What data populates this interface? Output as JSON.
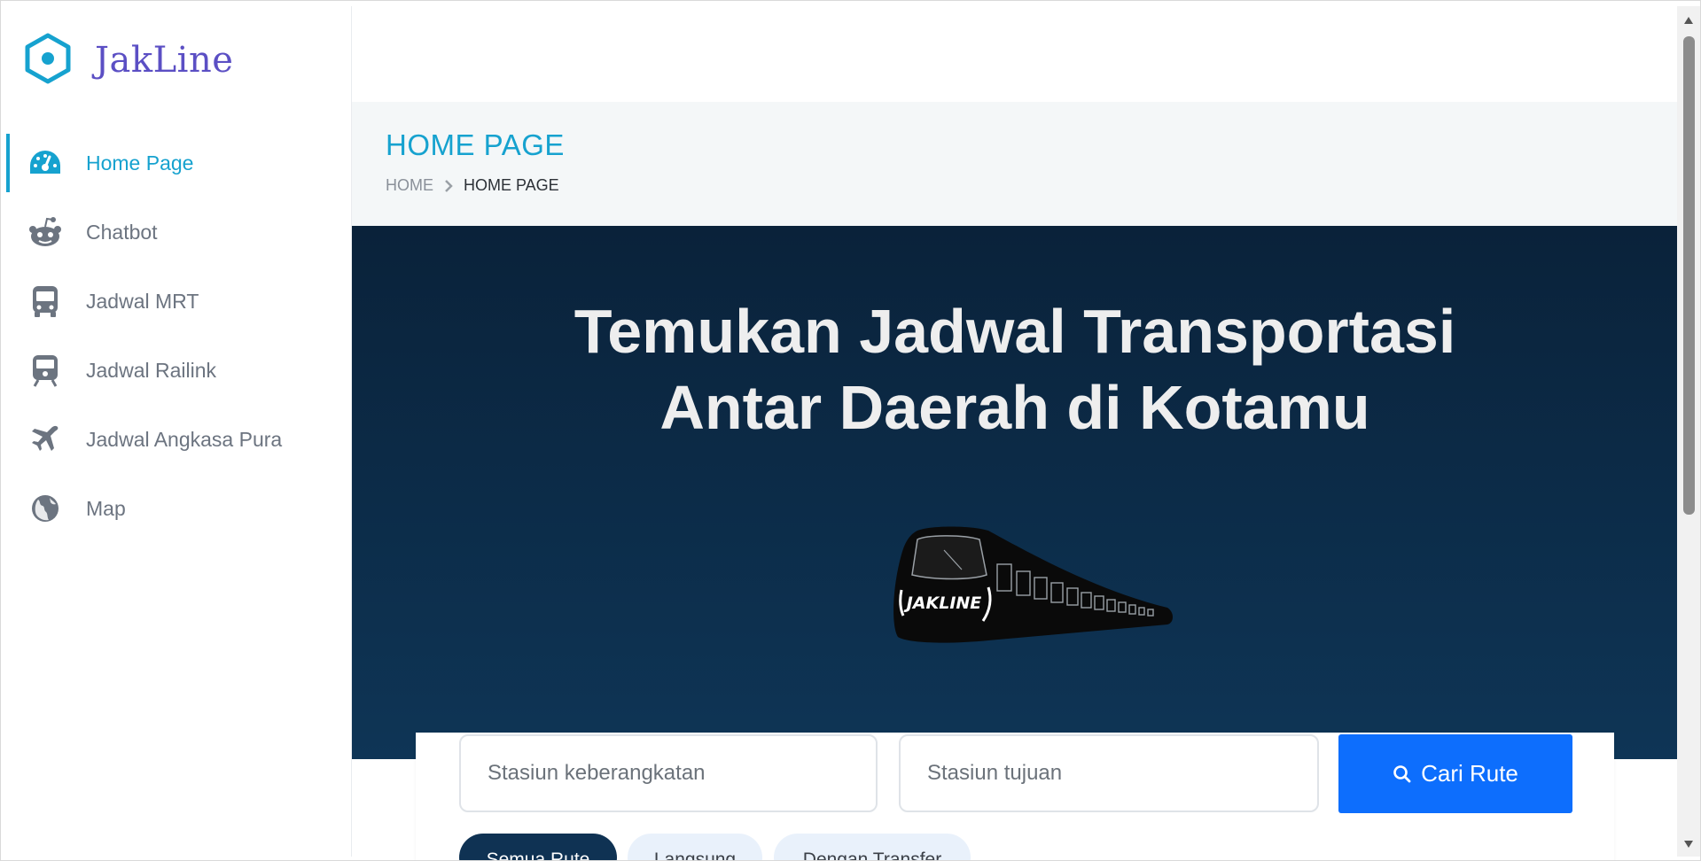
{
  "app": {
    "name": "JakLine"
  },
  "sidebar": {
    "items": [
      {
        "label": "Home Page",
        "icon": "dashboard-gauge-icon",
        "active": true
      },
      {
        "label": "Chatbot",
        "icon": "reddit-bot-icon",
        "active": false
      },
      {
        "label": "Jadwal MRT",
        "icon": "bus-icon",
        "active": false
      },
      {
        "label": "Jadwal Railink",
        "icon": "train-icon",
        "active": false
      },
      {
        "label": "Jadwal Angkasa Pura",
        "icon": "plane-icon",
        "active": false
      },
      {
        "label": "Map",
        "icon": "globe-icon",
        "active": false
      }
    ]
  },
  "page": {
    "title": "HOME PAGE",
    "breadcrumb": {
      "home": "HOME",
      "current": "HOME PAGE"
    }
  },
  "hero": {
    "headline_line1": "Temukan Jadwal Transportasi",
    "headline_line2": "Antar Daerah di Kotamu",
    "train_logo_text": "JAKLINE"
  },
  "search": {
    "from_placeholder": "Stasiun keberangkatan",
    "to_placeholder": "Stasiun tujuan",
    "button_label": "Cari Rute"
  },
  "filters": {
    "all": "Semua Rute",
    "direct": "Langsung",
    "transfer": "Dengan Transfer"
  },
  "colors": {
    "accent": "#16a2cf",
    "hero_top": "#0a223a",
    "hero_bottom": "#0e3556",
    "primary_button": "#0d6efd",
    "chip_active": "#0f3253",
    "chip_inactive": "#e9f1fb"
  }
}
